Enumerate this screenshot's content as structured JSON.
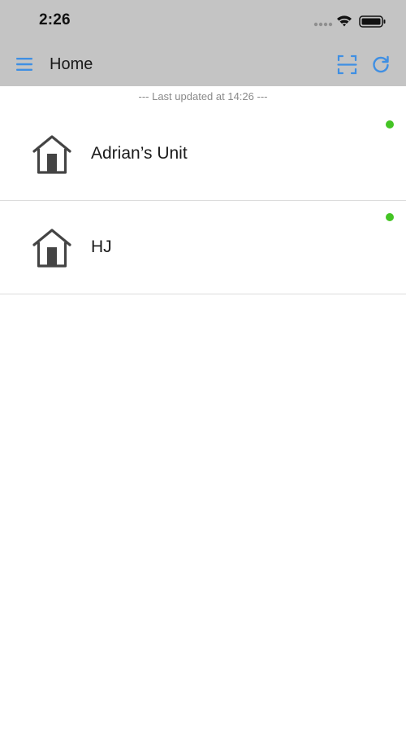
{
  "status_bar": {
    "time": "2:26",
    "icons": [
      "signal-icon",
      "wifi-icon",
      "battery-icon"
    ]
  },
  "header": {
    "title": "Home",
    "menu_icon": "menu-icon",
    "scan_icon": "scan-icon",
    "refresh_icon": "refresh-icon"
  },
  "last_updated": "--- Last updated at 14:26 ---",
  "devices": [
    {
      "name": "Adrian’s Unit",
      "icon": "house-icon",
      "status": "online"
    },
    {
      "name": "HJ",
      "icon": "house-icon",
      "status": "online"
    }
  ],
  "colors": {
    "accent": "#3f8fe3",
    "header_bg": "#c4c4c4",
    "online": "#44c424",
    "icon": "#444444"
  }
}
